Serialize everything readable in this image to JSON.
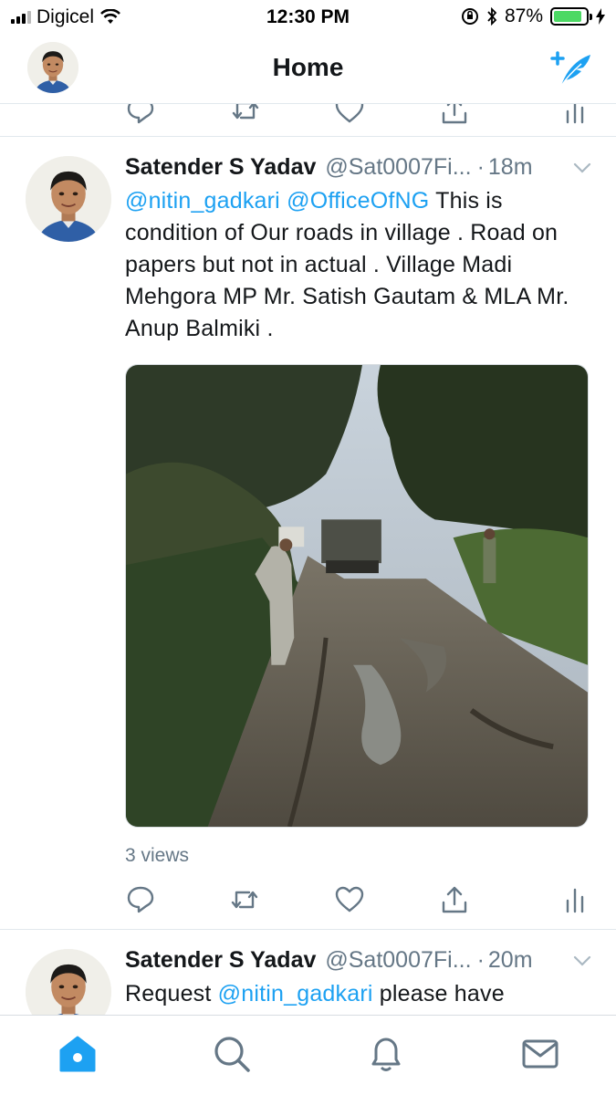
{
  "status_bar": {
    "carrier": "Digicel",
    "time": "12:30 PM",
    "battery_percent": "87%",
    "battery_level": 0.87
  },
  "header": {
    "title": "Home"
  },
  "tweets": [
    {
      "name": "Satender S Yadav",
      "handle": "@Sat0007Fi...",
      "dot": "·",
      "time": "18m",
      "text_parts": [
        {
          "text": "@nitin_gadkari",
          "mention": true
        },
        {
          "text": " "
        },
        {
          "text": "@OfficeOfNG",
          "mention": true
        },
        {
          "text": " This is condition of Our roads in village . Road on papers but not in actual . Village Madi Mehgora MP Mr. Satish Gautam & MLA Mr. Anup Balmiki ."
        }
      ],
      "views": "3 views"
    },
    {
      "name": "Satender S Yadav",
      "handle": "@Sat0007Fi...",
      "dot": "·",
      "time": "20m",
      "text_parts": [
        {
          "text": "Request "
        },
        {
          "text": "@nitin_gadkari",
          "mention": true
        },
        {
          "text": " please have"
        }
      ]
    }
  ],
  "icons": {
    "reply": "reply-icon",
    "retweet": "retweet-icon",
    "like": "heart-icon",
    "share": "share-icon",
    "analytics": "analytics-icon",
    "compose": "compose-tweet-icon",
    "tabs": [
      "home-icon",
      "search-icon",
      "notifications-icon",
      "messages-icon"
    ]
  },
  "colors": {
    "accent": "#1da1f2",
    "secondary_text": "#657786",
    "battery": "#4cd964"
  }
}
